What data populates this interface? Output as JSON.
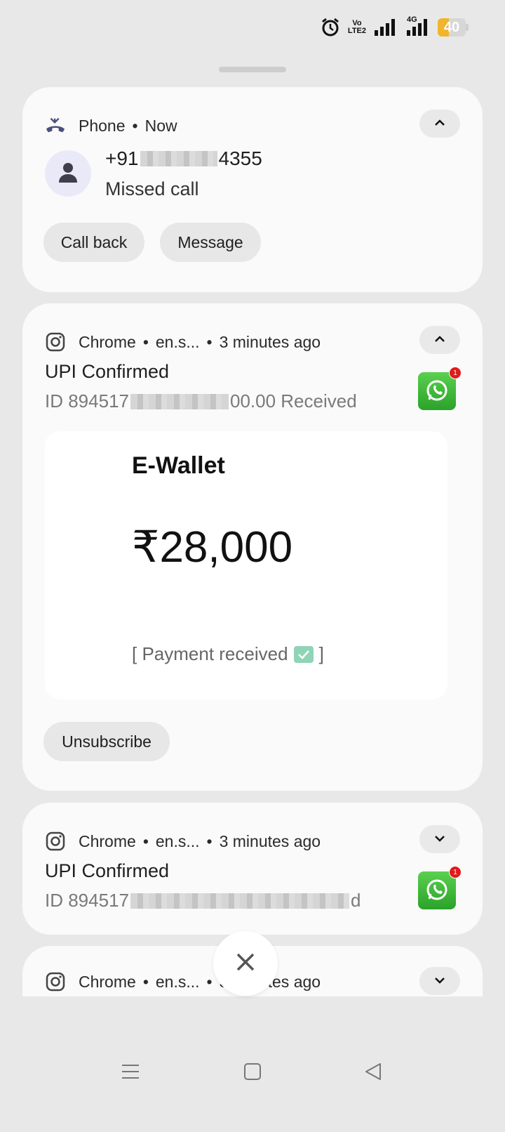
{
  "status_bar": {
    "volte_top": "Vo",
    "volte_bottom": "LTE2",
    "network": "4G",
    "battery_level": "40",
    "battery_fraction": 0.4,
    "battery_color": "#f0b52b",
    "icons": [
      "alarm-icon",
      "volte-icon",
      "signal-icon",
      "signal-4g-icon",
      "battery-icon"
    ]
  },
  "phone_notification": {
    "app_name": "Phone",
    "separator": "•",
    "time": "Now",
    "caller_prefix": "+91",
    "caller_suffix": "4355",
    "message": "Missed call",
    "actions": {
      "call_back": "Call back",
      "message": "Message"
    }
  },
  "chrome_notifications": [
    {
      "app_name": "Chrome",
      "separator": "•",
      "site": "en.s...",
      "time": "3 minutes ago",
      "title": "UPI Confirmed",
      "body_prefix": "ID 894517",
      "body_suffix": "00.00 Received",
      "badge_count": "1",
      "preview": {
        "title": "E-Wallet",
        "amount": "₹28,000",
        "status_open": "[ Payment received",
        "status_close": "]"
      },
      "action": "Unsubscribe"
    },
    {
      "app_name": "Chrome",
      "separator": "•",
      "site": "en.s...",
      "time": "3 minutes ago",
      "title": "UPI Confirmed",
      "body_prefix": "ID 894517",
      "body_suffix": "d",
      "badge_count": "1"
    },
    {
      "app_name": "Chrome",
      "separator": "•",
      "site": "en.s...",
      "time": "3 minutes ago"
    }
  ],
  "colors": {
    "background": "#e8e8e8",
    "card": "#fafafa",
    "whatsapp_green": "#2ba22a",
    "badge_red": "#e21b1b"
  }
}
